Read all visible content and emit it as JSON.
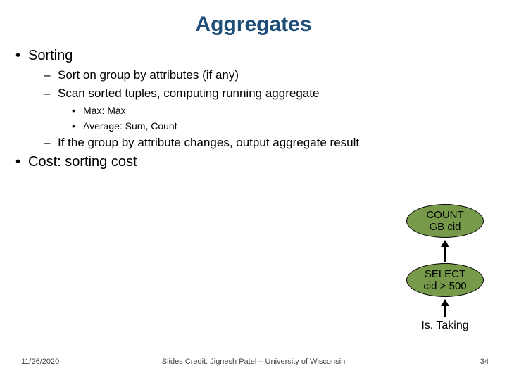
{
  "title": "Aggregates",
  "bullets": {
    "sorting": "Sorting",
    "sort_on_group": "Sort on group by attributes (if any)",
    "scan_sorted": "Scan sorted tuples, computing running aggregate",
    "max": "Max: Max",
    "average": "Average: Sum, Count",
    "if_change": "If the group by attribute changes, output aggregate result",
    "cost": "Cost: sorting cost"
  },
  "diagram": {
    "top": "COUNT\nGB cid",
    "mid": "SELECT\ncid > 500",
    "leaf": "Is. Taking"
  },
  "footer": {
    "date": "11/26/2020",
    "credit": "Slides Credit: Jignesh Patel – University of Wisconsin",
    "page": "34"
  }
}
